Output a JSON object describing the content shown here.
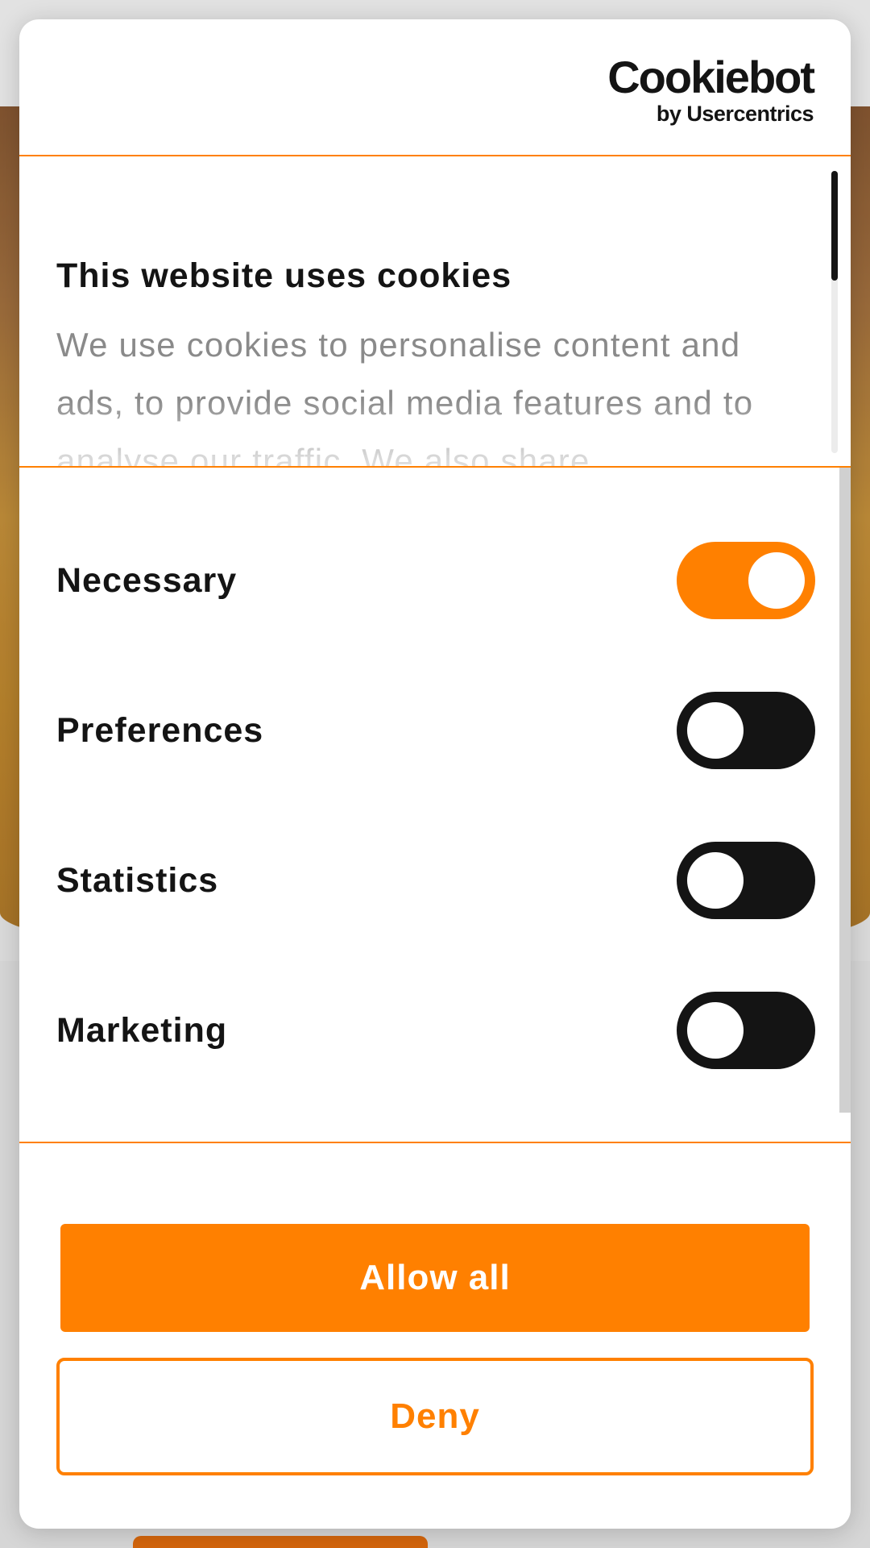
{
  "colors": {
    "accent": "#ff8000",
    "text": "#141414",
    "muted_text": "#8a8a8a",
    "switch_off": "#141414"
  },
  "header": {
    "logo_main": "Cookiebot",
    "logo_sub": "by Usercentrics"
  },
  "about": {
    "title": "This website uses cookies",
    "text": "We use cookies to personalise content and ads, to provide social media features and to analyse our traffic. We also share"
  },
  "toggles": [
    {
      "label": "Necessary",
      "checked": true
    },
    {
      "label": "Preferences",
      "checked": false
    },
    {
      "label": "Statistics",
      "checked": false
    },
    {
      "label": "Marketing",
      "checked": false
    }
  ],
  "buttons": {
    "allow_all": "Allow all",
    "deny": "Deny"
  }
}
